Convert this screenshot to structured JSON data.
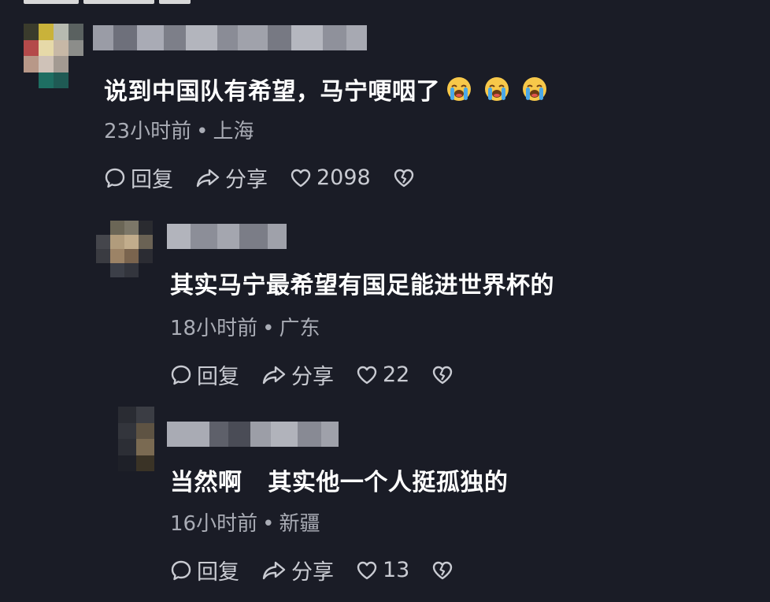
{
  "colors": {
    "background": "#1a1c26",
    "text_primary": "#ffffff",
    "text_meta": "#a9acb5",
    "action_text": "#c9cbd2"
  },
  "comments": [
    {
      "text": "说到中国队有希望，马宁哽咽了",
      "emojis": [
        "loudly-crying-face",
        "loudly-crying-face",
        "loudly-crying-face"
      ],
      "time": "23小时前",
      "location": "上海",
      "reply_label": "回复",
      "share_label": "分享",
      "likes": "2098"
    },
    {
      "text": "其实马宁最希望有国足能进世界杯的",
      "time": "18小时前",
      "location": "广东",
      "reply_label": "回复",
      "share_label": "分享",
      "likes": "22"
    },
    {
      "text": "当然啊   其实他一个人挺孤独的",
      "time": "16小时前",
      "location": "新疆",
      "reply_label": "回复",
      "share_label": "分享",
      "likes": "13"
    }
  ],
  "meta_separator": "•"
}
